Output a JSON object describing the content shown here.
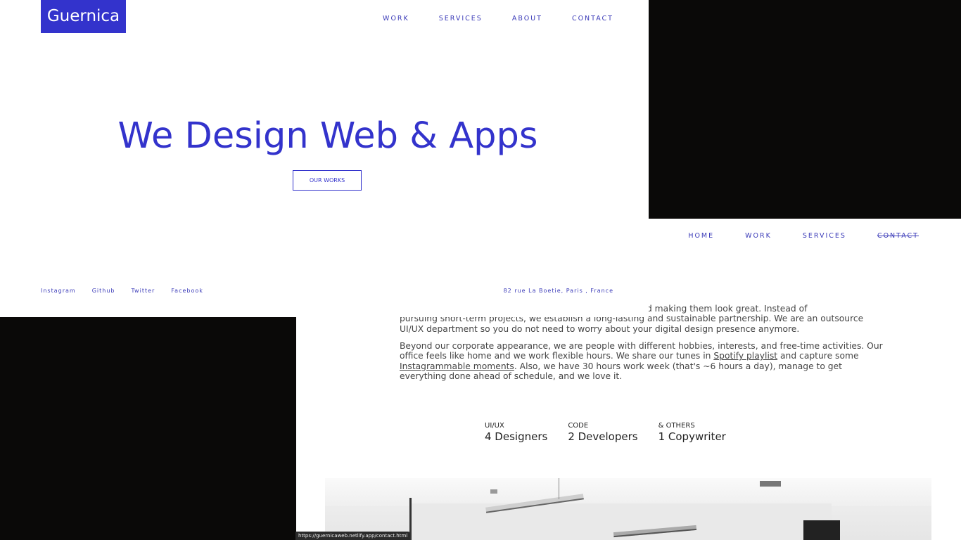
{
  "colors": {
    "brand": "#3333cc",
    "background": "#0a0908"
  },
  "home": {
    "logo": "Guernica",
    "nav": [
      "WORK",
      "SERVICES",
      "ABOUT",
      "CONTACT"
    ],
    "hero_title": "We Design Web & Apps",
    "cta_label": "OUR WORKS",
    "socials": [
      "Instagram",
      "Github",
      "Twitter",
      "Facebook"
    ],
    "address": "82 rue La Boetie, Paris , France"
  },
  "about": {
    "nav": [
      "HOME",
      "WORK",
      "SERVICES",
      "CONTACT"
    ],
    "para1": [
      "ons and making them look great. Instead of",
      "pursuing short-term projects, we establish a long-lasting and sustainable partnership. We are an outsource",
      "UI/UX department so you do not need to worry about your digital design presence anymore."
    ],
    "para2": {
      "line1": "Beyond our corporate appearance, we are people with different hobbies, interests, and free-time activities. Our",
      "line2_a": "office feels like home and we work flexible hours. We share our tunes in ",
      "spotify_link": "Spotify playlist",
      "line2_b": " and capture some",
      "insta_link": "Instagrammable moments",
      "line3_b": ". Also, we have 30 hours work week (that's ~6 hours a day), manage to get",
      "line4": "everything done ahead of schedule, and we love it."
    },
    "stats": [
      {
        "category": "UI/UX",
        "value": "4 Designers"
      },
      {
        "category": "CODE",
        "value": "2 Developers"
      },
      {
        "category": "& OTHERS",
        "value": "1 Copywriter"
      }
    ]
  },
  "status_url": "https://guernicaweb.netlify.app/contact.html"
}
